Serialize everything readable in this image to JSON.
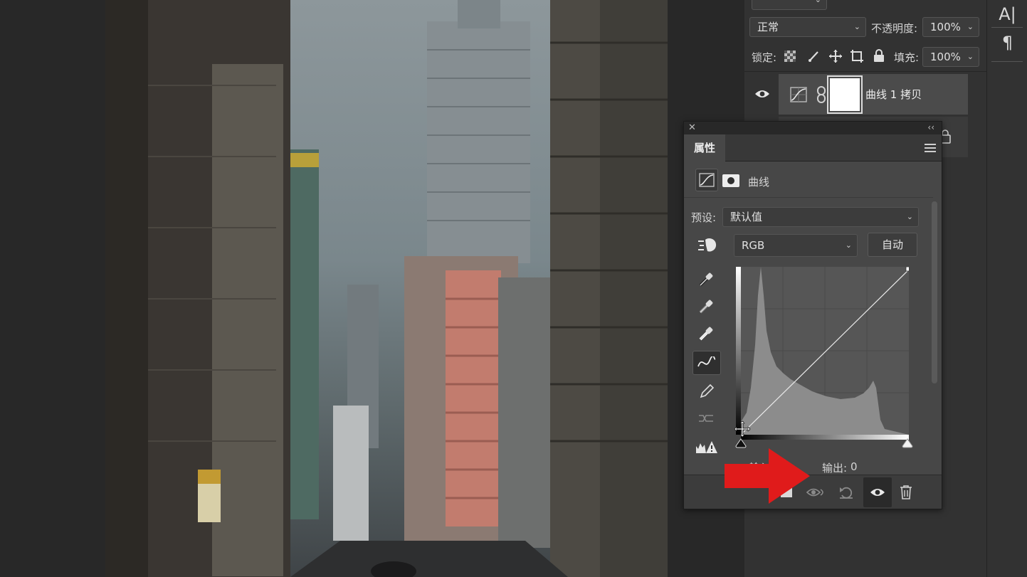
{
  "layers_panel": {
    "blend_mode": "正常",
    "opacity_label": "不透明度:",
    "opacity_value": "100%",
    "lock_label": "锁定:",
    "fill_label": "填充:",
    "fill_value": "100%",
    "active_layer": {
      "name": "曲线 1 拷贝"
    }
  },
  "right_strip": {
    "char_icon": "A|",
    "para_icon": "¶"
  },
  "properties": {
    "tab_label": "属性",
    "adjustment_name": "曲线",
    "preset_label": "预设:",
    "preset_value": "默认值",
    "channel_value": "RGB",
    "auto_button": "自动",
    "input_label": "输入",
    "output_label": "输出:",
    "output_value": "0"
  },
  "annotation": {
    "arrow_color": "#e01b1b"
  }
}
